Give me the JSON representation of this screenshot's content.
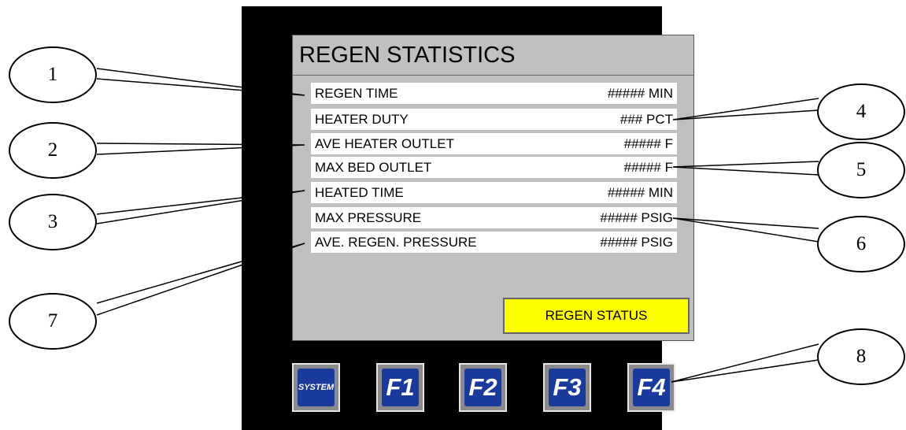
{
  "screen": {
    "title": "REGEN STATISTICS",
    "rows": [
      {
        "label": "REGEN TIME",
        "value": "##### MIN"
      },
      {
        "label": "HEATER DUTY",
        "value": "### PCT"
      },
      {
        "label": "AVE HEATER OUTLET",
        "value": "##### F"
      },
      {
        "label": "MAX BED OUTLET",
        "value": "##### F"
      },
      {
        "label": "HEATED TIME",
        "value": "##### MIN"
      },
      {
        "label": "MAX PRESSURE",
        "value": "##### PSIG"
      },
      {
        "label": "AVE. REGEN. PRESSURE",
        "value": "##### PSIG"
      }
    ],
    "regen_status_button": "REGEN STATUS"
  },
  "function_keys": [
    "SYSTEM",
    "F1",
    "F2",
    "F3",
    "F4"
  ],
  "callouts": [
    "1",
    "2",
    "3",
    "4",
    "5",
    "6",
    "7",
    "8"
  ],
  "colors": {
    "bezel": "#000000",
    "screen_background": "#bfbfbf",
    "regen_status_button": "#ffff00",
    "function_key": "#1a3a9c"
  },
  "icons": {
    "function_keys": "key-icon"
  }
}
